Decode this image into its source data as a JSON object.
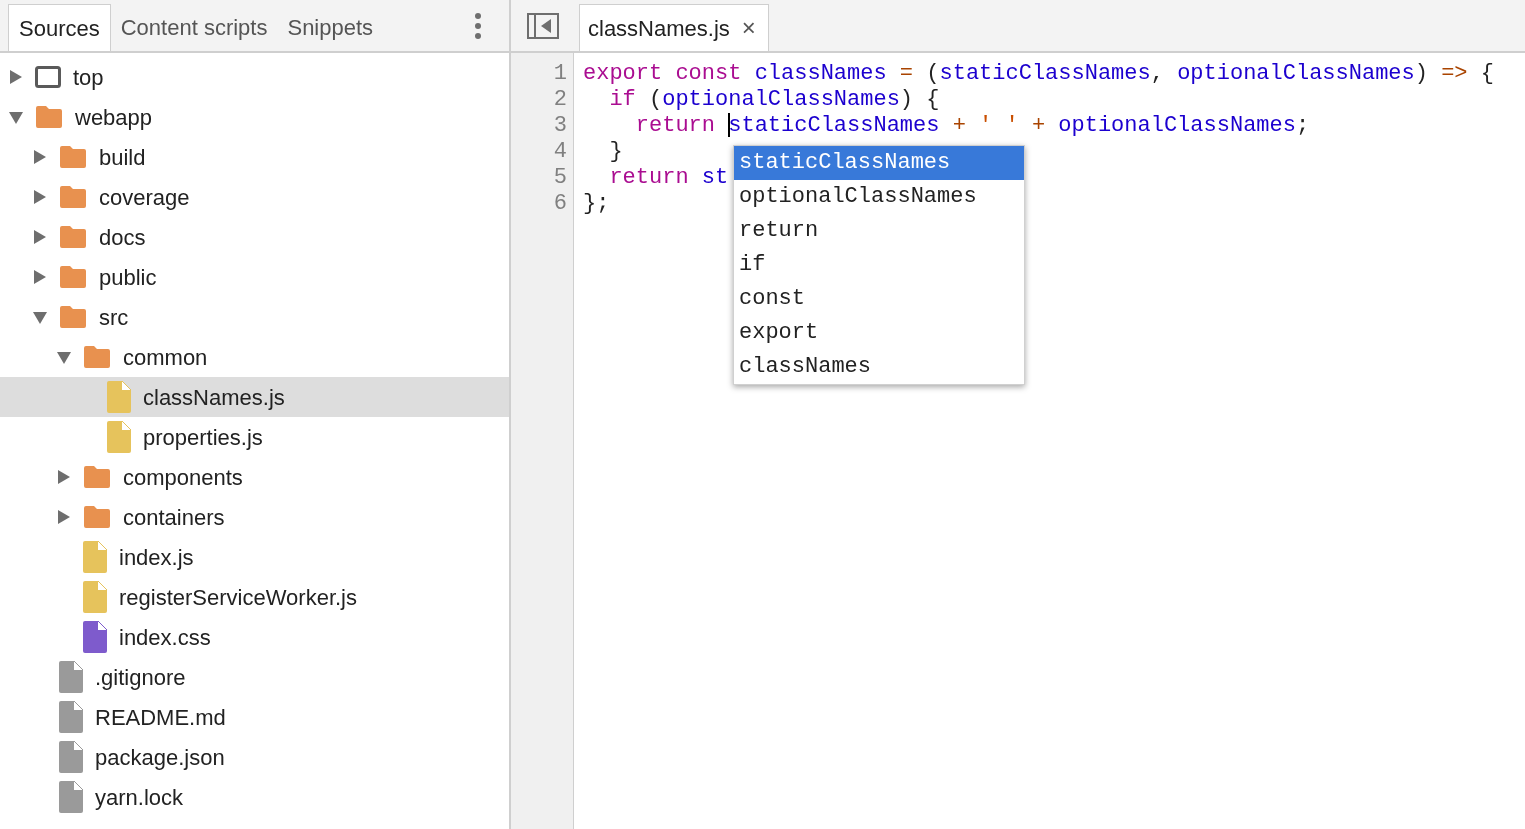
{
  "navigator": {
    "tabs": [
      {
        "label": "Sources",
        "selected": true
      },
      {
        "label": "Content scripts",
        "selected": false
      },
      {
        "label": "Snippets",
        "selected": false
      }
    ],
    "tree": [
      {
        "kind": "frame",
        "label": "top",
        "expanded": false,
        "selected": false
      },
      {
        "kind": "folder",
        "label": "webapp",
        "expanded": true,
        "selected": false,
        "children": [
          {
            "kind": "folder",
            "label": "build",
            "expanded": false,
            "selected": false
          },
          {
            "kind": "folder",
            "label": "coverage",
            "expanded": false,
            "selected": false
          },
          {
            "kind": "folder",
            "label": "docs",
            "expanded": false,
            "selected": false
          },
          {
            "kind": "folder",
            "label": "public",
            "expanded": false,
            "selected": false
          },
          {
            "kind": "folder",
            "label": "src",
            "expanded": true,
            "selected": false,
            "children": [
              {
                "kind": "folder",
                "label": "common",
                "expanded": true,
                "selected": false,
                "children": [
                  {
                    "kind": "script",
                    "label": "classNames.js",
                    "selected": true
                  },
                  {
                    "kind": "script",
                    "label": "properties.js",
                    "selected": false
                  }
                ]
              },
              {
                "kind": "folder",
                "label": "components",
                "expanded": false,
                "selected": false
              },
              {
                "kind": "folder",
                "label": "containers",
                "expanded": false,
                "selected": false
              },
              {
                "kind": "script",
                "label": "index.js",
                "selected": false
              },
              {
                "kind": "script",
                "label": "registerServiceWorker.js",
                "selected": false
              },
              {
                "kind": "stylesheet",
                "label": "index.css",
                "selected": false
              }
            ]
          },
          {
            "kind": "document",
            "label": ".gitignore",
            "selected": false
          },
          {
            "kind": "document",
            "label": "README.md",
            "selected": false
          },
          {
            "kind": "document",
            "label": "package.json",
            "selected": false
          },
          {
            "kind": "document",
            "label": "yarn.lock",
            "selected": false
          }
        ]
      }
    ]
  },
  "editor": {
    "tabs": [
      {
        "label": "classNames.js",
        "close": "×",
        "selected": true
      }
    ],
    "lines": [
      {
        "number": "1",
        "tokens": [
          {
            "kind": "keyword",
            "text": "export"
          },
          {
            "kind": "keyword",
            "text": " const"
          },
          {
            "kind": "name",
            "text": " classNames"
          },
          {
            "kind": "operator",
            "text": " ="
          },
          {
            "kind": "plain",
            "text": " ("
          },
          {
            "kind": "name",
            "text": "staticClassNames"
          },
          {
            "kind": "plain",
            "text": ", "
          },
          {
            "kind": "name",
            "text": "optionalClassNames"
          },
          {
            "kind": "plain",
            "text": ") "
          },
          {
            "kind": "operator",
            "text": "=>"
          },
          {
            "kind": "plain",
            "text": " {"
          }
        ]
      },
      {
        "number": "2",
        "tokens": [
          {
            "kind": "keyword",
            "text": "  if"
          },
          {
            "kind": "plain",
            "text": " ("
          },
          {
            "kind": "name",
            "text": "optionalClassNames"
          },
          {
            "kind": "plain",
            "text": ") {"
          }
        ]
      },
      {
        "number": "3",
        "tokens": [
          {
            "kind": "keyword",
            "text": "    return "
          },
          {
            "kind": "caret"
          },
          {
            "kind": "name",
            "text": "staticClassNames"
          },
          {
            "kind": "operator",
            "text": " +"
          },
          {
            "kind": "string",
            "text": " ' '"
          },
          {
            "kind": "operator",
            "text": " +"
          },
          {
            "kind": "name",
            "text": " optionalClassNames"
          },
          {
            "kind": "plain",
            "text": ";"
          }
        ]
      },
      {
        "number": "4",
        "tokens": [
          {
            "kind": "plain",
            "text": "  }"
          }
        ]
      },
      {
        "number": "5",
        "tokens": [
          {
            "kind": "keyword",
            "text": "  return"
          },
          {
            "kind": "name",
            "text": " st"
          }
        ]
      },
      {
        "number": "6",
        "tokens": [
          {
            "kind": "plain",
            "text": "};"
          }
        ]
      }
    ],
    "suggestions": [
      {
        "label": "staticClassNames",
        "selected": true
      },
      {
        "label": "optionalClassNames",
        "selected": false
      },
      {
        "label": "return",
        "selected": false
      },
      {
        "label": "if",
        "selected": false
      },
      {
        "label": "const",
        "selected": false
      },
      {
        "label": "export",
        "selected": false
      },
      {
        "label": "classNames",
        "selected": false
      }
    ]
  }
}
